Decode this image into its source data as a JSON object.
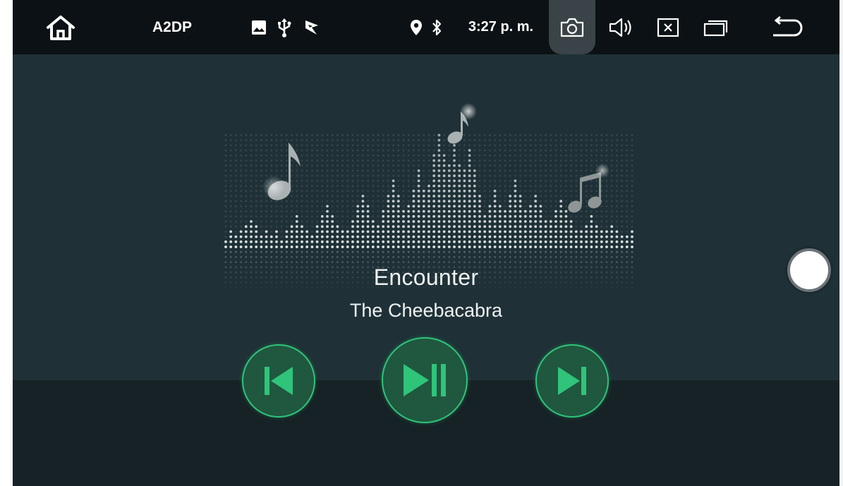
{
  "status_bar": {
    "profile_label": "A2DP",
    "time": "3:27 p. m.",
    "icons": [
      "home-icon",
      "gallery-icon",
      "usb-icon",
      "navigation-icon",
      "location-icon",
      "bluetooth-icon",
      "camera-icon",
      "volume-icon",
      "close-box-icon",
      "recents-icon",
      "back-icon"
    ]
  },
  "track": {
    "title": "Encounter",
    "artist": "The Cheebacabra"
  },
  "controls": {
    "icons": [
      "previous-icon",
      "play-pause-icon",
      "next-icon"
    ]
  },
  "colors": {
    "accent": "#2fc47a",
    "button_fill": "#20573f",
    "background": "#1f3136",
    "status_bar": "#0b1114"
  }
}
